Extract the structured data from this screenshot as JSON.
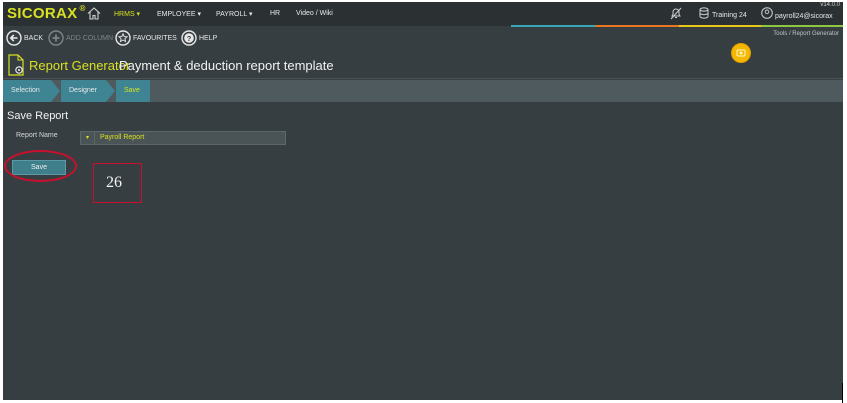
{
  "app": {
    "logo": "SICORAX",
    "logo_mark": "®",
    "version": "v14.0.0"
  },
  "nav": {
    "items": [
      {
        "label": "HRMS ▾",
        "active": true
      },
      {
        "label": "EMPLOYEE ▾",
        "active": false
      },
      {
        "label": "PAYROLL ▾",
        "active": false
      },
      {
        "label": "HR",
        "active": false
      },
      {
        "label": "Video / Wiki",
        "active": false
      }
    ],
    "training": "Training 24",
    "user": "payroll24@sicorax"
  },
  "colors": {
    "accent": "#d9e021",
    "bar_teal": "#3aa6b9",
    "bar_orange": "#e87722",
    "bar_yellow": "#e6c619",
    "bar_green": "#8dc63f"
  },
  "toolbar": {
    "back_label": "BACK",
    "add_column_label": "ADD COLUMN",
    "favourites_label": "FAVOURITES",
    "help_label": "HELP"
  },
  "breadcrumb": {
    "parent": "Tools /",
    "current": "Report Generator"
  },
  "title": {
    "main": "Report Generator",
    "sub": "Payment & deduction report template"
  },
  "steps": [
    {
      "label": "Selection",
      "active": false
    },
    {
      "label": "Designer",
      "active": false
    },
    {
      "label": "Save",
      "active": true
    }
  ],
  "form": {
    "section_title": "Save Report",
    "report_name_label": "Report Name",
    "report_name_value": "Payroll Report",
    "dropdown_glyph": "▾",
    "save_label": "Save"
  },
  "annotation": {
    "step_number": "26"
  }
}
